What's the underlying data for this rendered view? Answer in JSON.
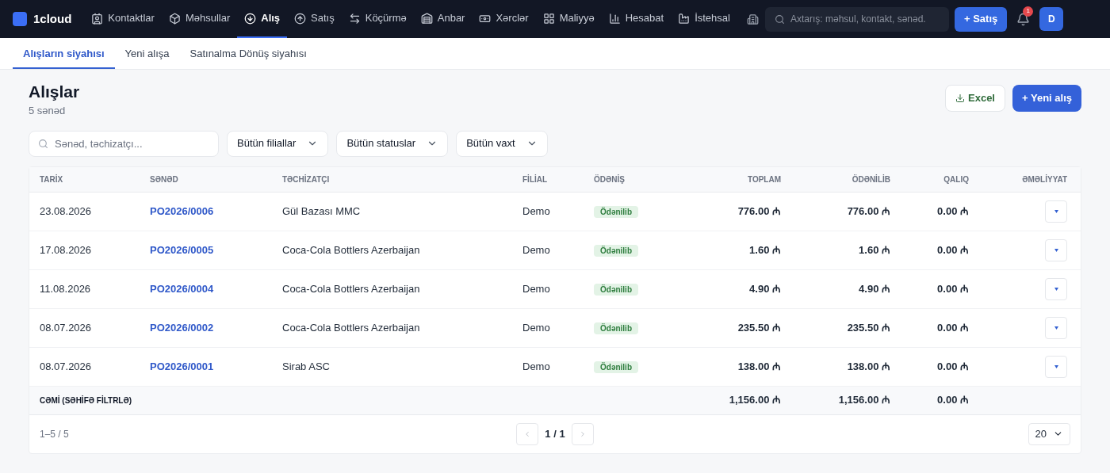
{
  "app": {
    "logo": "1cloud"
  },
  "nav": [
    {
      "label": "Kontaktlar",
      "selected": false
    },
    {
      "label": "Məhsullar",
      "selected": false
    },
    {
      "label": "Alış",
      "selected": true
    },
    {
      "label": "Satış",
      "selected": false
    },
    {
      "label": "Köçürmə",
      "selected": false
    },
    {
      "label": "Anbar",
      "selected": false
    },
    {
      "label": "Xərclər",
      "selected": false
    },
    {
      "label": "Maliyyə",
      "selected": false
    },
    {
      "label": "Hesabat",
      "selected": false
    },
    {
      "label": "İstehsal",
      "selected": false
    }
  ],
  "search": {
    "placeholder": "Axtarış: məhsul, kontakt, sənəd."
  },
  "new_sale_button": "+ Satış",
  "notifications": {
    "count": "1"
  },
  "avatar": "D",
  "subtabs": [
    {
      "label": "Alışların siyahısı",
      "selected": true
    },
    {
      "label": "Yeni alışa",
      "selected": false
    },
    {
      "label": "Satınalma Dönüş siyahısı",
      "selected": false
    }
  ],
  "page": {
    "title": "Alışlar",
    "subtitle": "5 sənəd",
    "excel_button": "Excel",
    "new_button": "+ Yeni alış"
  },
  "filters": {
    "search_placeholder": "Sənəd, təchizatçı...",
    "dropdowns": [
      "Bütün filiallar",
      "Bütün statuslar",
      "Bütün vaxt"
    ]
  },
  "table": {
    "columns": [
      "TARİX",
      "SƏNƏD",
      "TƏCHİZATÇI",
      "FİLİAL",
      "ÖDƏNİŞ",
      "TOPLAM",
      "ÖDƏNİLİB",
      "QALIQ",
      "ƏMƏLİYYAT"
    ],
    "rows": [
      {
        "date": "23.08.2026",
        "doc": "PO2026/0006",
        "supplier": "Gül Bazası MMC",
        "branch": "Demo",
        "status": "Ödənilib",
        "color": "#e3f3e6",
        "total": "776.00 ₼",
        "paid": "776.00 ₼",
        "rest": "0.00 ₼"
      },
      {
        "date": "17.08.2026",
        "doc": "PO2026/0005",
        "supplier": "Coca-Cola Bottlers Azerbaijan",
        "branch": "Demo",
        "status": "Ödənilib",
        "color": "#e3f3e6",
        "total": "1.60 ₼",
        "paid": "1.60 ₼",
        "rest": "0.00 ₼"
      },
      {
        "date": "11.08.2026",
        "doc": "PO2026/0004",
        "supplier": "Coca-Cola Bottlers Azerbaijan",
        "branch": "Demo",
        "status": "Ödənilib",
        "color": "#e3f3e6",
        "total": "4.90 ₼",
        "paid": "4.90 ₼",
        "rest": "0.00 ₼"
      },
      {
        "date": "08.07.2026",
        "doc": "PO2026/0002",
        "supplier": "Coca-Cola Bottlers Azerbaijan",
        "branch": "Demo",
        "status": "Ödənilib",
        "color": "#e3f3e6",
        "total": "235.50 ₼",
        "paid": "235.50 ₼",
        "rest": "0.00 ₼"
      },
      {
        "date": "08.07.2026",
        "doc": "PO2026/0001",
        "supplier": "Sirab ASC",
        "branch": "Demo",
        "status": "Ödənilib",
        "color": "#e3f3e6",
        "total": "138.00 ₼",
        "paid": "138.00 ₼",
        "rest": "0.00 ₼"
      }
    ],
    "totals": {
      "label": "CƏMİ (SƏHİFƏ FİLTRLƏ)",
      "total": "1,156.00 ₼",
      "paid": "1,156.00 ₼",
      "rest": "0.00 ₼"
    }
  },
  "pagination": {
    "range": "1–5 / 5",
    "page": "1 / 1",
    "page_size": "20"
  }
}
